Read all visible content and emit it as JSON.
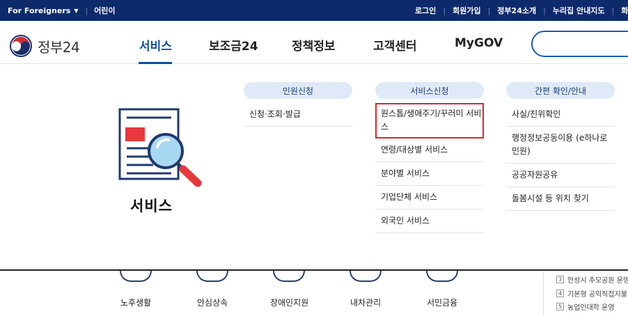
{
  "topbar": {
    "foreigners": "For Foreigners",
    "kids": "어린이",
    "links": [
      "로그인",
      "회원가입",
      "정부24소개",
      "누리집 안내지도",
      "화"
    ]
  },
  "header": {
    "logo_text": "정부24",
    "gnb": [
      "서비스",
      "보조금24",
      "정책정보",
      "고객센터",
      "MyGOV"
    ],
    "active": "서비스"
  },
  "mega": {
    "title": "서비스",
    "columns": [
      {
        "head": "민원신청",
        "items": [
          "신청·조회·발급"
        ]
      },
      {
        "head": "서비스신청",
        "items": [
          "원스톱/생애주기/꾸러미 서비스",
          "연령/대상별 서비스",
          "분야별 서비스",
          "기업단체 서비스",
          "외국인 서비스"
        ]
      },
      {
        "head": "간편 확인/안내",
        "items": [
          "사실/진위확인",
          "행정정보공동이용 (e하나로민원)",
          "공공자원공유",
          "돌봄시설 등 위치 찾기"
        ]
      }
    ]
  },
  "background": {
    "categories": [
      "노후생활",
      "안심상속",
      "장애인지원",
      "내차관리",
      "서민금융"
    ],
    "news": [
      {
        "num": "3",
        "text": "안성시 추모공원 운영"
      },
      {
        "num": "4",
        "text": "기본형 공익직접지불"
      },
      {
        "num": "5",
        "text": "농업인대학 운영"
      }
    ]
  },
  "colors": {
    "topbar": "#0d2a6b",
    "accent": "#0b4ea2",
    "column_head_bg": "#dfe9f8",
    "highlight": "#d9252b"
  }
}
